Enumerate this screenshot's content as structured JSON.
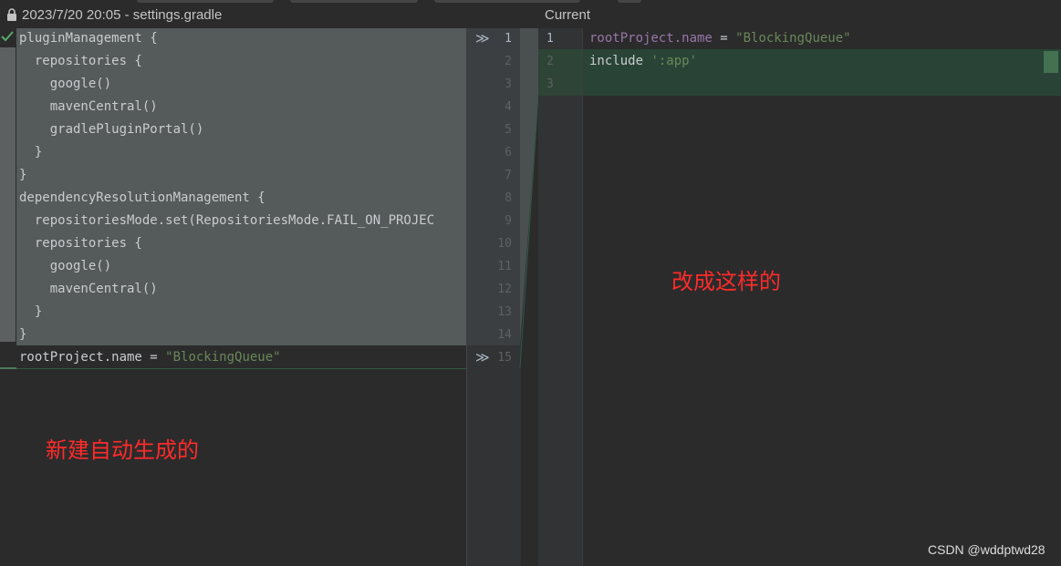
{
  "left_pane": {
    "title": "2023/7/20 20:05 - settings.gradle",
    "lines": [
      "pluginManagement {",
      "  repositories {",
      "    google()",
      "    mavenCentral()",
      "    gradlePluginPortal()",
      "  }",
      "}",
      "dependencyResolutionManagement {",
      "  repositoriesMode.set(RepositoriesMode.FAIL_ON_PROJEC",
      "  repositories {",
      "    google()",
      "    mavenCentral()",
      "  }",
      "}"
    ],
    "last_line_prefix": "rootProject.name = ",
    "last_line_string": "\"BlockingQueue\""
  },
  "middle_gutter": {
    "numbers": [
      "1",
      "2",
      "3",
      "4",
      "5",
      "6",
      "7",
      "8",
      "9",
      "10",
      "11",
      "12",
      "13",
      "14",
      "15"
    ],
    "chevron": "≫"
  },
  "right_pane": {
    "title": "Current",
    "numbers": [
      "1",
      "2",
      "3"
    ],
    "line1_prop": "rootProject.name",
    "line1_eq": " = ",
    "line1_string": "\"BlockingQueue\"",
    "line2_kw": "include ",
    "line2_string": "':app'"
  },
  "annotations": {
    "left_note": "新建自动生成的",
    "right_note": "改成这样的",
    "color": "#ff2b2b"
  },
  "watermark": "CSDN @wddptwd28",
  "colors": {
    "changed_block": "#555a5a",
    "added_block": "#294436",
    "string": "#6a8759",
    "property": "#9876aa"
  }
}
